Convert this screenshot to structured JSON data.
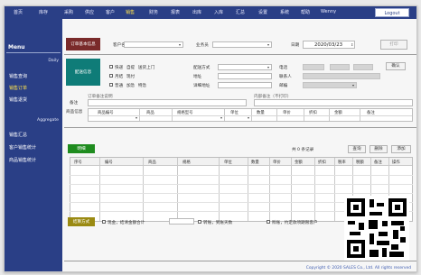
{
  "nav": {
    "items": [
      "首页",
      "库存",
      "采购",
      "供应",
      "客户",
      "销售",
      "财务",
      "报表",
      "出库",
      "入库",
      "汇总",
      "设置",
      "系统",
      "帮助",
      "Wenny"
    ],
    "active_index": 5,
    "logout_label": "Logout"
  },
  "sidebar": {
    "title": "Menu",
    "group1": "Daily",
    "items1": [
      "销售查询",
      "销售订单",
      "销售退货"
    ],
    "active_item1": 1,
    "group2": "Aggregate",
    "items2": [
      "销售汇总",
      "客户销售统计",
      "商品销售统计"
    ]
  },
  "form": {
    "section1_tag": "订单基本信息",
    "customer_label": "客户名",
    "salesman_label": "业务员",
    "date_label": "日期",
    "date_value": "2020/03/23",
    "print_button": "打印",
    "section2_tag": "配送信息",
    "delivery_type_label": "配送方式",
    "address_label": "地址",
    "address_detail_label": "详细地址",
    "phone_label": "电话",
    "contact_label": "联系人",
    "zip_label": "邮编",
    "option_row1": "快递  自提  送货上门",
    "option_row2": "月结  现付",
    "option_row3": "普通  加急  特急",
    "confirm_button": "确认",
    "remark_label": "备注",
    "remark_hint": "订单备注说明",
    "internal_hint": "内部备注（不打印）"
  },
  "goods_header": {
    "row_label": "商品信息",
    "columns": [
      "商品编号",
      "商品",
      "规格型号",
      "单位",
      "数量",
      "单价",
      "折扣",
      "金额",
      "备注"
    ]
  },
  "list": {
    "tag": "明细",
    "summary": "共 0 条记录",
    "search_button": "查询",
    "delete_button": "删除",
    "add_button": "添加",
    "columns": [
      "序号",
      "编号",
      "商品",
      "规格",
      "单位",
      "数量",
      "单价",
      "金额",
      "折扣",
      "税率",
      "税额",
      "备注",
      "操作"
    ]
  },
  "payment": {
    "tag": "结算方式",
    "opt1": "现金，结清金额合计",
    "opt2": "转账，到账天数",
    "opt3": "赊账，约定款项期限客户"
  },
  "footer": "Copyright © 2020 SALES Co., Ltd. All rights reserved",
  "colors": {
    "nav": "#2a3f86",
    "tag_red": "#7a2a2a",
    "tag_teal": "#0f7c78",
    "tag_green": "#1f8c1f",
    "tag_olive": "#9a8a12",
    "active": "#ffe34d"
  }
}
